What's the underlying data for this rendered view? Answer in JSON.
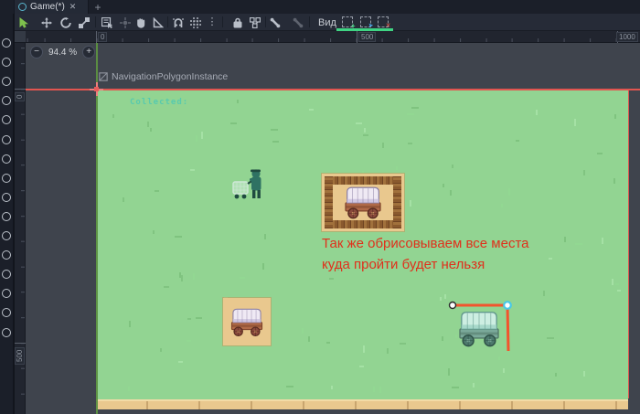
{
  "tabbar": {
    "scene_tab_label": "Game(*)"
  },
  "toolbar": {
    "view_menu_label": "Вид",
    "tools": [
      "select",
      "move",
      "rotate",
      "scale",
      "list-select",
      "pivot",
      "pan",
      "ruler",
      "smart-snap",
      "grid-snap",
      "snap-options",
      "lock",
      "group",
      "bone",
      "bone-paint",
      "nav-create",
      "nav-edit",
      "nav-delete"
    ]
  },
  "icons": {
    "overflow_glyph": "⋮",
    "snap_options_glyph": "⋮",
    "close_glyph": "✕",
    "new_tab_glyph": "+",
    "zoom_out_glyph": "−",
    "zoom_in_glyph": "+",
    "nav_create_glyph": "+",
    "nav_edit_glyph": "➤",
    "nav_delete_glyph": "✕"
  },
  "viewport": {
    "zoom_value": "94.4 %",
    "selected_node_label": "NavigationPolygonInstance",
    "ruler_top_labels": [
      "0",
      "500",
      "1000"
    ],
    "ruler_left_labels": [
      "0",
      "500"
    ]
  },
  "scene": {
    "hud_text": "Collected:",
    "annotation_line1": "Так же обрисовываем все места",
    "annotation_line2": "куда пройти будет нельзя"
  },
  "colors": {
    "annotation_red": "#e0301c",
    "map_green": "#92d492",
    "path_tan": "#e9c88e",
    "outline_red": "#e25550",
    "polyline_orange": "#f2542d",
    "axis_green": "#5d9141",
    "active_tool_green": "#7ec04d",
    "nav_underline_green": "#3fd483",
    "hud_teal": "#4ec9b4",
    "selected_vertex_cyan": "#49c8e8"
  },
  "sprites": {
    "wagon_brown": {
      "cover": "#efe9f4",
      "cover_shade": "#c9bfdd",
      "cover_line": "#8d81a4",
      "body": "#b06a48",
      "body_dark": "#7e432a",
      "wheel": "#8a4a3c",
      "wheel_dark": "#55291f",
      "hub": "#d8a06a"
    },
    "wagon_teal": {
      "cover": "#cdeee2",
      "cover_shade": "#9ed2c4",
      "cover_line": "#62998c",
      "body": "#7aa99a",
      "body_dark": "#527868",
      "wheel": "#4e7a6e",
      "wheel_dark": "#2f5248",
      "hub": "#8fc0ae"
    },
    "character_body": "#2f7263",
    "character_dark": "#1f4a40",
    "cart_light": "#cfe8d8"
  }
}
